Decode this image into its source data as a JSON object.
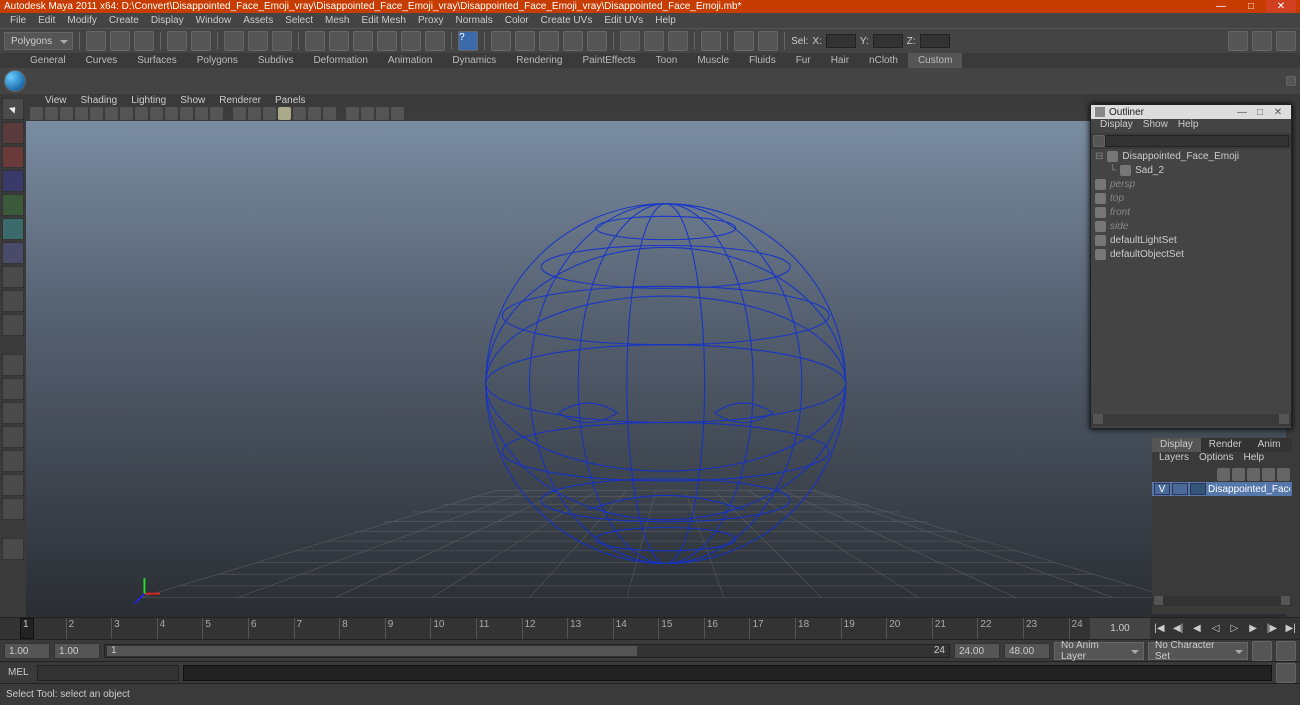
{
  "app": {
    "title": "Autodesk Maya 2011 x64: D:\\Convert\\Disappointed_Face_Emoji_vray\\Disappointed_Face_Emoji_vray\\Disappointed_Face_Emoji_vray\\Disappointed_Face_Emoji.mb*"
  },
  "menu": [
    "File",
    "Edit",
    "Modify",
    "Create",
    "Display",
    "Window",
    "Assets",
    "Select",
    "Mesh",
    "Edit Mesh",
    "Proxy",
    "Normals",
    "Color",
    "Create UVs",
    "Edit UVs",
    "Help"
  ],
  "mode_dropdown": "Polygons",
  "hud": {
    "x_label": "X:",
    "y_label": "Y:",
    "z_label": "Z:"
  },
  "tabs": [
    "General",
    "Curves",
    "Surfaces",
    "Polygons",
    "Subdivs",
    "Deformation",
    "Animation",
    "Dynamics",
    "Rendering",
    "PaintEffects",
    "Toon",
    "Muscle",
    "Fluids",
    "Fur",
    "Hair",
    "nCloth",
    "Custom"
  ],
  "tabs_active": 16,
  "viewport_menu": [
    "View",
    "Shading",
    "Lighting",
    "Show",
    "Renderer",
    "Panels"
  ],
  "outliner": {
    "title": "Outliner",
    "menu": [
      "Display",
      "Show",
      "Help"
    ],
    "items": [
      {
        "label": "Disappointed_Face_Emoji",
        "dim": false,
        "indent": 0
      },
      {
        "label": "Sad_2",
        "dim": false,
        "indent": 1
      },
      {
        "label": "persp",
        "dim": true,
        "indent": 0
      },
      {
        "label": "top",
        "dim": true,
        "indent": 0
      },
      {
        "label": "front",
        "dim": true,
        "indent": 0
      },
      {
        "label": "side",
        "dim": true,
        "indent": 0
      },
      {
        "label": "defaultLightSet",
        "dim": false,
        "indent": 0
      },
      {
        "label": "defaultObjectSet",
        "dim": false,
        "indent": 0
      }
    ]
  },
  "channelbox": {
    "tabs": [
      "Display",
      "Render",
      "Anim"
    ],
    "active": 0,
    "menu": [
      "Layers",
      "Options",
      "Help"
    ],
    "row": {
      "v": "V",
      "name": "Disappointed_Face_Emoj"
    }
  },
  "timeline": {
    "ticks": [
      "1",
      "2",
      "3",
      "4",
      "5",
      "6",
      "7",
      "8",
      "9",
      "10",
      "11",
      "12",
      "13",
      "14",
      "15",
      "16",
      "17",
      "18",
      "19",
      "20",
      "21",
      "22",
      "23",
      "24"
    ],
    "current": "1.00",
    "range_start": "1.00",
    "range_end": "1.00",
    "range_pos_left": "1",
    "range_pos_right": "24",
    "total_start": "24.00",
    "total_end": "48.00",
    "anim_layer": "No Anim Layer",
    "char_set": "No Character Set"
  },
  "cmd": {
    "label": "MEL"
  },
  "help": {
    "text": "Select Tool: select an object"
  }
}
